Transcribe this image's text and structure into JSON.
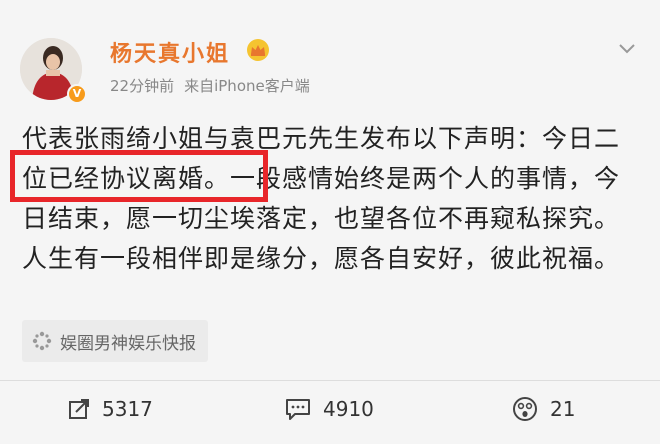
{
  "post": {
    "username": "杨天真小姐",
    "time": "22分钟前",
    "source": "来自iPhone客户端",
    "text": "代表张雨绮小姐与袁巴元先生发布以下声明：今日二位已经协议离婚。一段感情始终是两个人的事情，今日结束，愿一切尘埃落定，也望各位不再窥私探究。人生有一段相伴即是缘分，愿各自安好，彼此祝福。",
    "highlighted_phrase": "二位已经协议离婚。",
    "source_tag": "娱圈男神娱乐快报",
    "highlight_color": "#e8262a",
    "username_color": "#e8772e"
  },
  "actions": {
    "reposts": "5317",
    "comments": "4910",
    "likes": "21"
  },
  "icons": {
    "verified": "verified-badge-icon",
    "crown": "crown-icon",
    "dropdown": "chevron-down-icon",
    "repost": "repost-icon",
    "comment": "comment-icon",
    "like": "surprised-face-icon",
    "tag": "sparkle-icon"
  }
}
